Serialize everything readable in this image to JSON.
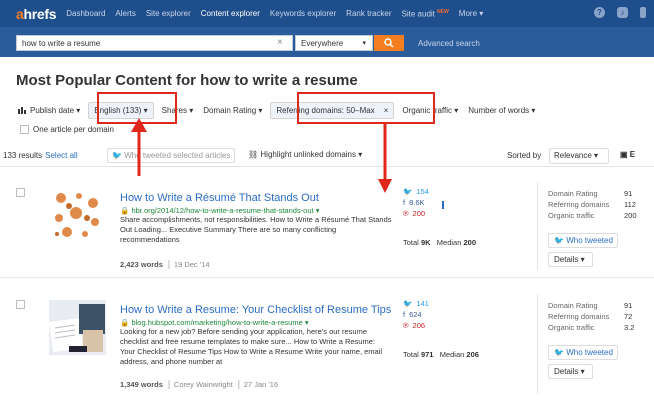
{
  "nav": {
    "logo_a": "a",
    "logo_rest": "hrefs",
    "items": [
      "Dashboard",
      "Alerts",
      "Site explorer",
      "Content explorer",
      "Keywords explorer",
      "Rank tracker",
      "Site audit",
      "More ▾"
    ],
    "new_badge": "NEW",
    "accent": "#f57e20"
  },
  "search": {
    "query": "how to write a resume",
    "clear": "×",
    "mode": "Everywhere",
    "button_icon": "search-icon",
    "advanced": "Advanced search"
  },
  "title": "Most Popular Content for how to write a resume",
  "filters": {
    "publish_date": "Publish date ▾",
    "language": "English (133) ▾",
    "shares": "Shares ▾",
    "domain_rating": "Domain Rating ▾",
    "ref_domains": "Referring domains: 50–Max",
    "ref_domains_x": "×",
    "organic": "Organic traffic ▾",
    "words": "Number of words ▾",
    "one_per_domain": "One article per domain"
  },
  "controls": {
    "results": "133 results",
    "select_all": "Select all",
    "who_tweeted": "Who tweeted selected articles",
    "highlight": "Highlight unlinked domains ▾",
    "sorted_by": "Sorted by",
    "sort_value": "Relevance ▾",
    "export": "E"
  },
  "results": [
    {
      "title": "How to Write a Résumé That Stands Out",
      "url": "hbr.org/2014/12/how-to-write-a-resume-that-stands-out ▾",
      "snippet": "Share accomplishments, not responsibilities. How to Write a Résumé That Stands Out Loading... Executive Summary There are so many conflicting recommendations",
      "words": "2,423 words",
      "author": "",
      "date": "19 Dec '14",
      "twitter": "154",
      "facebook": "8.6K",
      "pinterest": "200",
      "total_label": "Total",
      "total": "9K",
      "median_label": "Median",
      "median": "200",
      "dr_label": "Domain Rating",
      "dr": "91",
      "rd_label": "Referring domains",
      "rd": "112",
      "ot_label": "Organic traffic",
      "ot": "200",
      "who_label": "Who tweeted",
      "details_label": "Details ▾"
    },
    {
      "title": "How to Write a Resume: Your Checklist of Resume Tips",
      "url": "blog.hubspot.com/marketing/how-to-write-a-resume ▾",
      "snippet": "Looking for a new job? Before sending your application, here's our resume checklist and free resume templates to make sure... How to Write a Resume: Your Checklist of Resume Tips How to Write a Resume Write your name, email address, and phone number at",
      "words": "1,349 words",
      "author": "Corey Wainwright",
      "date": "27 Jan '16",
      "twitter": "141",
      "facebook": "624",
      "pinterest": "206",
      "total_label": "Total",
      "total": "971",
      "median_label": "Median",
      "median": "206",
      "dr_label": "Domain Rating",
      "dr": "91",
      "rd_label": "Referring domains",
      "rd": "72",
      "ot_label": "Organic traffic",
      "ot": "3.2",
      "who_label": "Who tweeted",
      "details_label": "Details ▾"
    }
  ],
  "colors": {
    "nav_bg": "#1f4e8c",
    "link": "#2a6dc2",
    "url": "#1e8a3a",
    "annotation": "#e0271c"
  }
}
